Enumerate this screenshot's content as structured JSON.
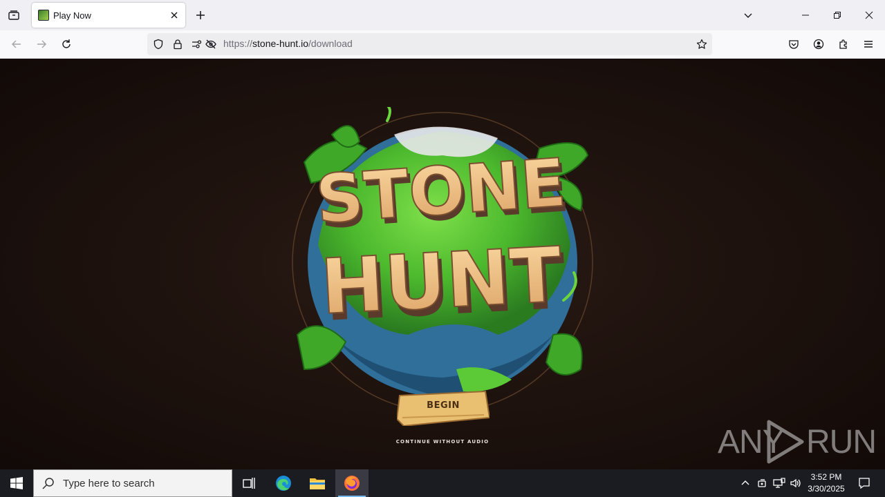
{
  "browser": {
    "tab": {
      "title": "Play Now",
      "favicon": "stone-hunt-favicon"
    },
    "url": {
      "scheme": "https://",
      "host": "stone-hunt.io",
      "path": "/download"
    },
    "icons": [
      "tab-list-icon",
      "close-icon",
      "plus-icon",
      "chevron-down-icon",
      "minimize-icon",
      "restore-icon",
      "window-close-icon",
      "back-icon",
      "forward-icon",
      "reload-icon",
      "shield-icon",
      "lock-icon",
      "permissions-icon",
      "tracking-off-icon",
      "bookmark-star-icon",
      "pocket-icon",
      "account-icon",
      "extensions-icon",
      "menu-icon"
    ]
  },
  "game": {
    "logo_line1": "STONE",
    "logo_line2": "HUNT",
    "begin_label": "BEGIN",
    "no_audio_label": "CONTINUE WITHOUT AUDIO"
  },
  "watermark": {
    "text_left": "ANY",
    "text_right": "RUN"
  },
  "taskbar": {
    "search_placeholder": "Type here to search",
    "time": "3:52 PM",
    "date": "3/30/2025"
  },
  "colors": {
    "page_bg": "#1c110d",
    "globe_green": "#5cc936",
    "globe_blue": "#2f6f9a",
    "logo_wood": "#f0c48a",
    "logo_shadow": "#5a3a2a",
    "button_wood": "#e9c071",
    "taskbar_bg": "#1b1b22"
  }
}
